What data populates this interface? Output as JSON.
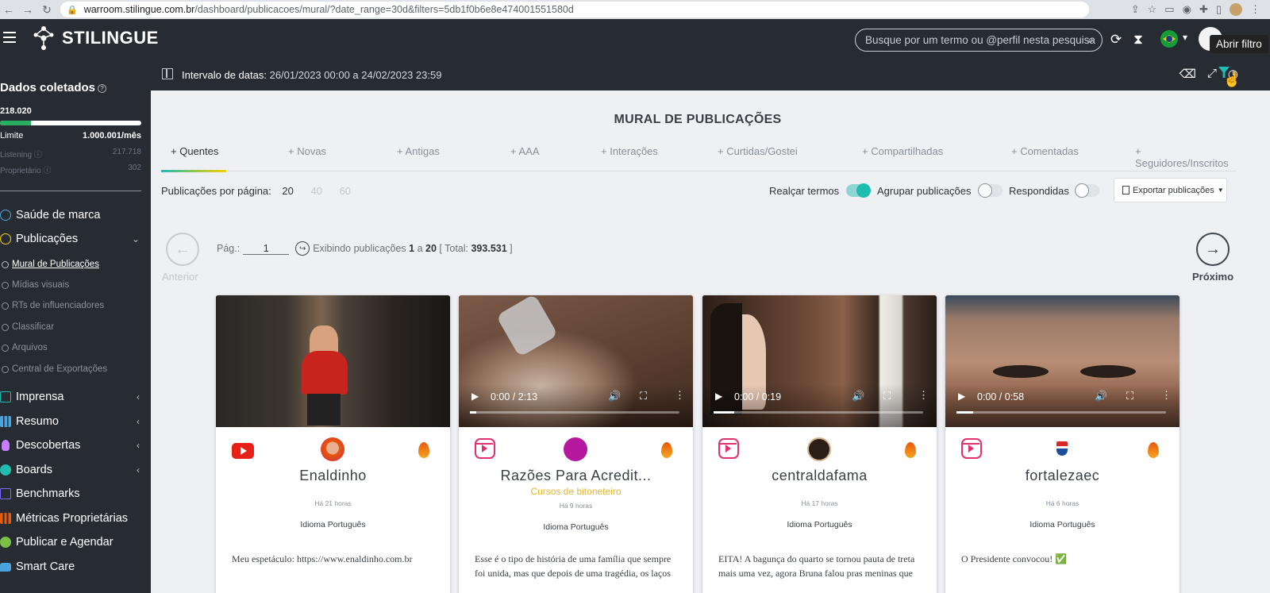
{
  "browser": {
    "url_host": "warroom.stilingue.com.br",
    "url_path": "/dashboard/publicacoes/mural/?date_range=30d&filters=5db1f0b6e8e474001551580d"
  },
  "header": {
    "brand": "STILINGUE",
    "search_placeholder": "Busque por um termo ou @perfil nesta pesquisa",
    "tooltip": "Abrir filtro"
  },
  "datebar": {
    "label": "Intervalo de datas:",
    "value": "26/01/2023 00:00 a 24/02/2023 23:59"
  },
  "sidebar": {
    "title": "Dados coletados",
    "total": "218.020",
    "usage_fraction": 0.218,
    "limit_label": "Limite",
    "limit_value": "1.000.001/mês",
    "listening_label": "Listening",
    "listening_value": "217.718",
    "owner_label": "Proprietário",
    "owner_value": "302",
    "menu": [
      {
        "label": "Saúde de marca",
        "color": "#4aa3df"
      },
      {
        "label": "Publicações",
        "color": "#f5d000"
      },
      {
        "label": "Imprensa",
        "color": "#1fbcb2"
      },
      {
        "label": "Resumo",
        "color": "#4aa3df"
      },
      {
        "label": "Descobertas",
        "color": "#c77dff"
      },
      {
        "label": "Boards",
        "color": "#1fbcb2"
      },
      {
        "label": "Benchmarks",
        "color": "#7b6cf6"
      },
      {
        "label": "Métricas Proprietárias",
        "color": "#e8590c"
      },
      {
        "label": "Publicar e Agendar",
        "color": "#7bc043"
      },
      {
        "label": "Smart Care",
        "color": "#4aa3df"
      }
    ],
    "subitems": [
      "Mural de Publicações",
      "Mídias visuais",
      "RTs de influenciadores",
      "Classificar",
      "Arquivos",
      "Central de Exportações"
    ]
  },
  "main": {
    "title": "MURAL DE PUBLICAÇÕES",
    "tabs": [
      "+ Quentes",
      "+ Novas",
      "+ Antigas",
      "+ AAA",
      "+ Interações",
      "+ Curtidas/Gostei",
      "+ Compartilhadas",
      "+ Comentadas",
      "+ Seguidores/Inscritos"
    ],
    "per_page_label": "Publicações por página:",
    "per_page_options": [
      "20",
      "40",
      "60"
    ],
    "toggle_highlight": "Realçar termos",
    "toggle_group": "Agrupar publicações",
    "toggle_answered": "Respondidas",
    "export_label": "Exportar publicações",
    "prev_label": "Anterior",
    "next_label": "Próximo",
    "page_label": "Pág.:",
    "page_value": "1",
    "showing_prefix": "Exibindo publicações",
    "range_start": "1",
    "range_sep": "a",
    "range_end": "20",
    "total_prefix": "[ Total:",
    "total_value": "393.531",
    "total_suffix": "]"
  },
  "cards": [
    {
      "name": "Enaldinho",
      "subtitle": "",
      "time": "Há 21 horas",
      "language": "Idioma Português",
      "text": "Meu espetáculo: https://www.enaldinho.com.br",
      "video_time": ""
    },
    {
      "name": "Razões Para Acredit...",
      "subtitle": "Cursos de bitoneteiro",
      "time": "Há 9 horas",
      "language": "Idioma Português",
      "text": "Esse é o tipo de história de uma família que sempre foi unida, mas que depois de uma tragédia, os laços",
      "video_time": "0:00 / 2:13"
    },
    {
      "name": "centraldafama",
      "subtitle": "",
      "time": "Há 17 horas",
      "language": "Idioma Português",
      "text": "EITA! A bagunça do quarto se tornou pauta de treta mais uma vez, agora Bruna falou pras meninas que",
      "video_time": "0:00 / 0:19"
    },
    {
      "name": "fortalezaec",
      "subtitle": "",
      "time": "Há 6 horas",
      "language": "Idioma Português",
      "text": "O Presidente convocou! ✅",
      "video_time": "0:00 / 0:58"
    }
  ]
}
